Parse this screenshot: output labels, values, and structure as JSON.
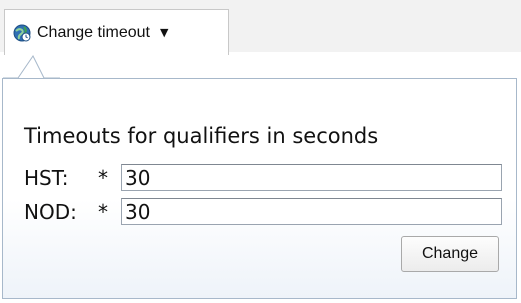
{
  "toolbar": {
    "dropdown_label": "Change timeout",
    "dropdown_icon": "timeout-globe-icon",
    "caret_glyph": "▼"
  },
  "panel": {
    "title": "Timeouts for qualifiers in seconds",
    "fields": [
      {
        "label": "HST:",
        "required_mark": "*",
        "value": "30"
      },
      {
        "label": "NOD:",
        "required_mark": "*",
        "value": "30"
      }
    ],
    "submit_label": "Change"
  },
  "colors": {
    "panel_border": "#a7b8ca",
    "icon_blue": "#2f6fb3",
    "icon_green": "#3fa34d"
  }
}
